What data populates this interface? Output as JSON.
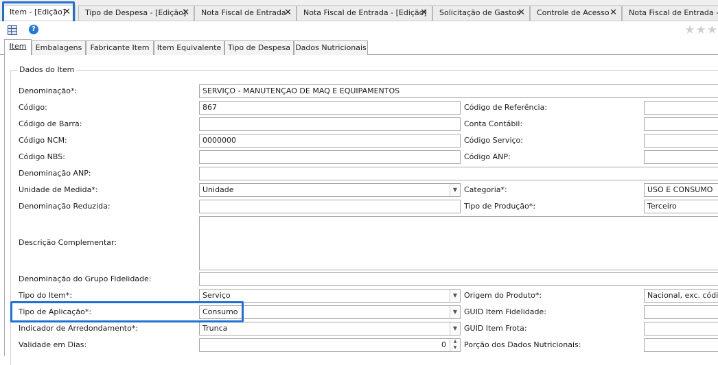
{
  "doc_tabs": [
    {
      "label": "Item - [Edição]",
      "close": "✕"
    },
    {
      "label": "Tipo de Despesa - [Edição]",
      "close": "✕"
    },
    {
      "label": "Nota Fiscal de Entrada",
      "close": "✕"
    },
    {
      "label": "Nota Fiscal de Entrada - [Edição]",
      "close": "✕"
    },
    {
      "label": "Solicitação de Gastos",
      "close": "✕"
    },
    {
      "label": "Controle de Acesso",
      "close": "✕"
    },
    {
      "label": "Nota Fiscal de Entrada - [Ed"
    }
  ],
  "toolbar": {
    "help": "?",
    "stars": "★★★"
  },
  "inner_tabs": [
    "Item",
    "Embalagens",
    "Fabricante Item",
    "Item Equivalente",
    "Tipo de Despesa",
    "Dados Nutricionais"
  ],
  "group_title": "Dados do Item",
  "left_fields": {
    "denominacao": {
      "label": "Denominação*:",
      "value": "SERVIÇO - MANUTENÇAO DE MAQ E EQUIPAMENTOS"
    },
    "codigo": {
      "label": "Código:",
      "value": "867"
    },
    "codigo_barra": {
      "label": "Código de Barra:",
      "value": ""
    },
    "codigo_ncm": {
      "label": "Código NCM:",
      "value": "0000000"
    },
    "codigo_nbs": {
      "label": "Código NBS:",
      "value": ""
    },
    "denominacao_anp": {
      "label": "Denominação ANP:",
      "value": ""
    },
    "unidade_medida": {
      "label": "Unidade de Medida*:",
      "value": "Unidade"
    },
    "denominacao_reduzida": {
      "label": "Denominação Reduzida:",
      "value": ""
    },
    "descricao_complementar": {
      "label": "Descrição Complementar:",
      "value": ""
    },
    "denominacao_grupo_fidelidade": {
      "label": "Denominação do Grupo Fidelidade:",
      "value": ""
    },
    "tipo_item": {
      "label": "Tipo do Item*:",
      "value": "Serviço"
    },
    "tipo_aplicacao": {
      "label": "Tipo de Aplicação*:",
      "value": "Consumo"
    },
    "indicador_arredondamento": {
      "label": "Indicador de Arredondamento*:",
      "value": "Trunca"
    },
    "validade_dias": {
      "label": "Validade em Dias:",
      "value": "0"
    }
  },
  "right_fields": {
    "codigo_referencia": {
      "label": "Código de Referência:",
      "value": ""
    },
    "conta_contabil": {
      "label": "Conta Contábil:",
      "value": ""
    },
    "codigo_servico": {
      "label": "Código Serviço:",
      "value": ""
    },
    "codigo_anp": {
      "label": "Código ANP:",
      "value": ""
    },
    "categoria": {
      "label": "Categoria*:",
      "value": "USO E CONSUMO"
    },
    "tipo_producao": {
      "label": "Tipo de Produção*:",
      "value": "Terceiro"
    },
    "origem_produto": {
      "label": "Origem do Produto*:",
      "value": "Nacional, exc. códigos"
    },
    "guid_fidelidade": {
      "label": "GUID Item Fidelidade:",
      "value": ""
    },
    "guid_frota": {
      "label": "GUID Item Frota:",
      "value": ""
    },
    "porcao_nutricionais": {
      "label": "Porção dos Dados Nutricionais:",
      "value": ""
    }
  },
  "glyphs": {
    "dropdown": "▼",
    "spin_up": "▲",
    "spin_down": "▼"
  }
}
